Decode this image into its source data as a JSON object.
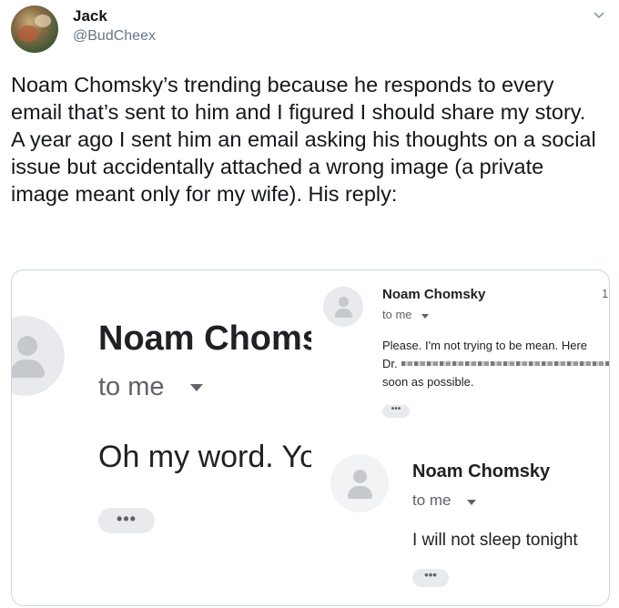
{
  "tweet": {
    "display_name": "Jack",
    "handle": "@BudCheex",
    "text": "Noam Chomsky’s trending because he responds to every email that’s sent to him and I figured I should share my story. A year ago I sent him an email asking his thoughts on a social issue but accidentally attached a wrong image (a private image meant only for my wife). His reply:"
  },
  "media": {
    "left_email": {
      "sender": "Noam Choms",
      "recipient": "to me",
      "body": "Oh my word. Yo",
      "more_label": "•••"
    },
    "top_right_email": {
      "sender": "Noam Chomsky",
      "count": "1",
      "recipient": "to me",
      "line1": "Please. I'm not trying to be mean. Here",
      "line2": "Dr.",
      "line3": "soon as possible.",
      "more_label": "•••"
    },
    "bottom_right_email": {
      "sender": "Noam Chomsky",
      "recipient": "to me",
      "body": "I will not sleep tonight",
      "more_label": "•••"
    }
  }
}
